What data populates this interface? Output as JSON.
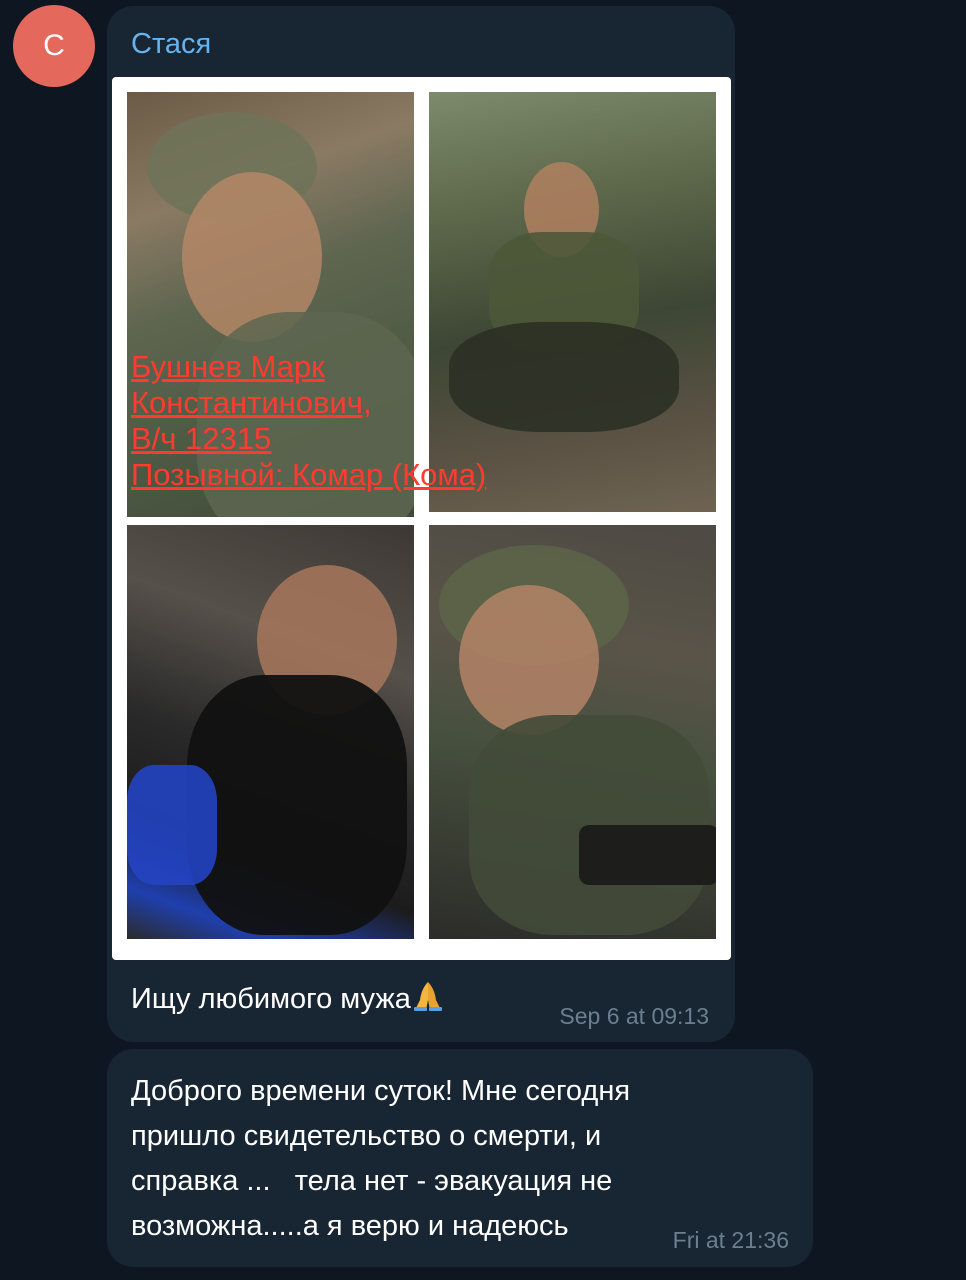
{
  "avatar": {
    "letter": "С",
    "color": "#e5685d"
  },
  "message1": {
    "sender": "Стася",
    "photo_overlay_lines": [
      "Бушнев Марк",
      "Константинович,",
      "В/ч 12315",
      "Позывной: Комар (Кома)"
    ],
    "caption": "Ищу любимого мужа",
    "emoji_icon": "folded-hands-icon",
    "time": "Sep 6 at 09:13"
  },
  "message2": {
    "lines": [
      "Доброго времени суток! Мне сегодня",
      "пришло свидетельство о смерти, и",
      "справка ...   тела нет - эвакуация не",
      "возможна.....а я верю и надеюсь"
    ],
    "time": "Fri at 21:36"
  },
  "colors": {
    "background": "#0e1621",
    "bubble": "#182533",
    "sender_name": "#64b5ef",
    "overlay_text": "#ff3b2f",
    "timestamp": "#6d7f8f"
  }
}
